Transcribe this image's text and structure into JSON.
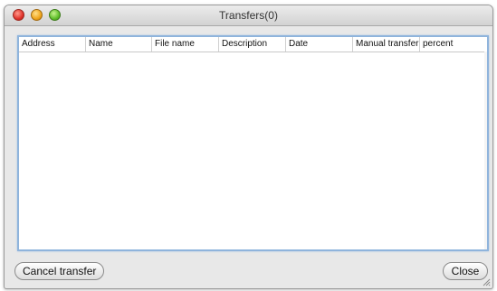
{
  "window": {
    "title": "Transfers(0)"
  },
  "table": {
    "columns": [
      {
        "label": "Address"
      },
      {
        "label": "Name"
      },
      {
        "label": "File name"
      },
      {
        "label": "Description"
      },
      {
        "label": "Date"
      },
      {
        "label": "Manual transfer"
      },
      {
        "label": "percent"
      }
    ],
    "rows": []
  },
  "buttons": {
    "cancel_transfer": "Cancel transfer",
    "close": "Close"
  },
  "colors": {
    "table_border": "#8fb4dc",
    "window_bg": "#e8e8e8"
  },
  "icons": {
    "close": "close-window-icon",
    "minimize": "minimize-window-icon",
    "maximize": "zoom-window-icon",
    "resize": "resize-grip-icon"
  }
}
